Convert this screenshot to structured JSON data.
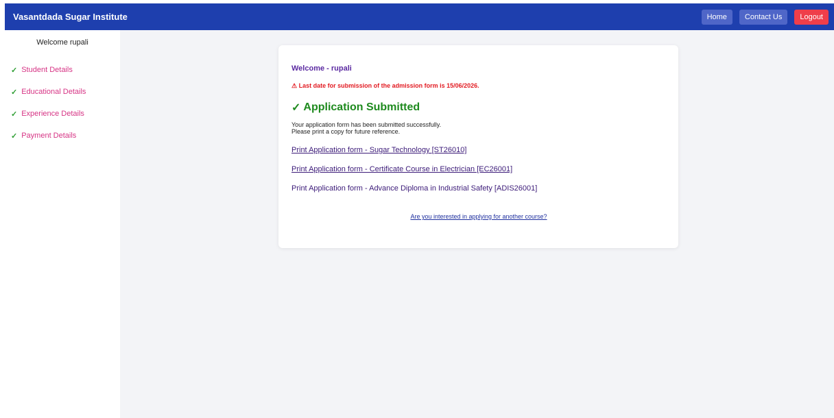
{
  "header": {
    "brand": "Vasantdada Sugar Institute",
    "buttons": {
      "home": "Home",
      "contact": "Contact Us",
      "logout": "Logout"
    },
    "colors": {
      "bar": "#1e3fae",
      "secondary_button": "#4f66c8",
      "logout_button": "#ef3e4a"
    }
  },
  "sidebar": {
    "welcome": "Welcome rupali",
    "items": [
      {
        "label": "Student Details",
        "icon": "check-icon"
      },
      {
        "label": "Educational Details",
        "icon": "check-icon"
      },
      {
        "label": "Experience Details",
        "icon": "check-icon"
      },
      {
        "label": "Payment Details",
        "icon": "check-icon"
      }
    ]
  },
  "card": {
    "welcome": "Welcome - rupali",
    "deadline": "⚠ Last date for submission of the admission form is 15/06/2026.",
    "status_icon": "✓",
    "status": "Application Submitted",
    "message_line1": "Your application form has been submitted successfully.",
    "message_line2": "Please print a copy for future reference.",
    "print_links": [
      "Print Application form - Sugar Technology [ST26010]",
      "Print Application form - Certificate Course in Electrician [EC26001]",
      "Print Application form - Advance Diploma in Industrial Safety [ADIS26001]"
    ],
    "apply_other": "Are you interested in applying for another course?"
  }
}
